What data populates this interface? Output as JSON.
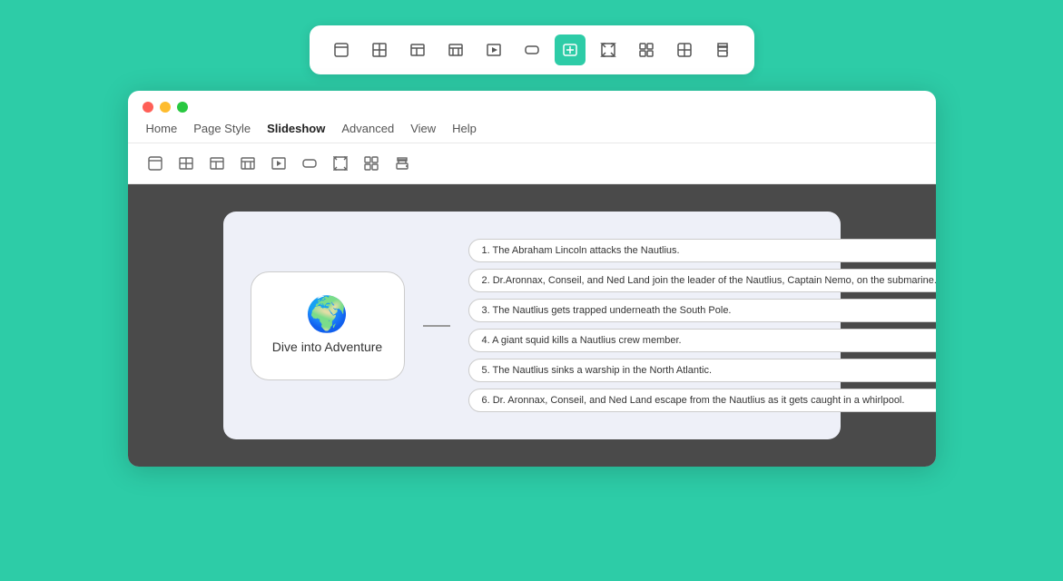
{
  "topToolbar": {
    "buttons": [
      {
        "name": "insert-frame",
        "icon": "frame",
        "active": false
      },
      {
        "name": "insert-table",
        "icon": "table",
        "active": false
      },
      {
        "name": "insert-table2",
        "icon": "table2",
        "active": false
      },
      {
        "name": "insert-table3",
        "icon": "table3",
        "active": false
      },
      {
        "name": "insert-play",
        "icon": "play",
        "active": false
      },
      {
        "name": "insert-input",
        "icon": "input",
        "active": false
      },
      {
        "name": "insert-active",
        "icon": "active",
        "active": true
      },
      {
        "name": "insert-expand",
        "icon": "expand",
        "active": false
      },
      {
        "name": "insert-grid",
        "icon": "grid",
        "active": false
      },
      {
        "name": "insert-grid2",
        "icon": "grid2",
        "active": false
      },
      {
        "name": "insert-print",
        "icon": "print",
        "active": false
      }
    ]
  },
  "window": {
    "menuItems": [
      "Home",
      "Page Style",
      "Slideshow",
      "Advanced",
      "View",
      "Help"
    ],
    "activeMenu": "Slideshow"
  },
  "slide": {
    "centerNodeText": "Dive into Adventure",
    "items": [
      "1. The Abraham Lincoln attacks the Nautlius.",
      "2. Dr.Aronnax, Conseil, and Ned Land join the leader of the Nautlius, Captain Nemo, on the submarine.",
      "3. The Nautlius gets trapped underneath the South Pole.",
      "4. A giant squid kills a Nautlius crew member.",
      "5. The Nautlius sinks a warship in the North Atlantic.",
      "6. Dr. Aronnax, Conseil, and Ned Land escape from the Nautlius as it gets caught in a whirlpool."
    ]
  }
}
